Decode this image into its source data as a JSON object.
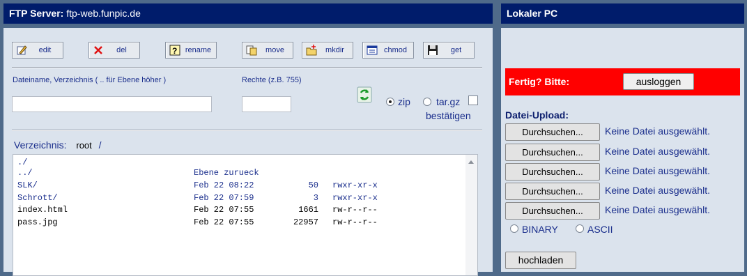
{
  "ftp": {
    "title_label": "FTP Server:",
    "host": "ftp-web.funpic.de",
    "toolbar": [
      {
        "label": "edit",
        "icon": "edit-icon"
      },
      {
        "label": "del",
        "icon": "delete-icon"
      },
      {
        "label": "rename",
        "icon": "rename-icon"
      },
      {
        "label": "move",
        "icon": "move-icon"
      },
      {
        "label": "mkdir",
        "icon": "mkdir-icon"
      },
      {
        "label": "chmod",
        "icon": "chmod-icon"
      },
      {
        "label": "get",
        "icon": "get-icon"
      }
    ],
    "filename_label": "Dateiname, Verzeichnis ( .. für Ebene höher )",
    "filename_value": "",
    "rights_label": "Rechte (z.B. 755)",
    "rights_value": "",
    "zip_label": "zip",
    "targz_label": "tar.gz",
    "confirm_label": "bestätigen",
    "dir_label": "Verzeichnis:",
    "dir_root": "root",
    "dir_sep": "/",
    "files": [
      {
        "name": "./",
        "date": "",
        "size": "",
        "perm": "",
        "link": true
      },
      {
        "name": "../",
        "date": "Ebene zurueck",
        "size": "",
        "perm": "",
        "link": true
      },
      {
        "name": "SLK/",
        "date": "Feb 22 08:22",
        "size": "50",
        "perm": "rwxr-xr-x",
        "link": true
      },
      {
        "name": "Schrott/",
        "date": "Feb 22 07:59",
        "size": "3",
        "perm": "rwxr-xr-x",
        "link": true
      },
      {
        "name": "index.html",
        "date": "Feb 22 07:55",
        "size": "1661",
        "perm": "rw-r--r--",
        "link": false
      },
      {
        "name": "pass.jpg",
        "date": "Feb 22 07:55",
        "size": "22957",
        "perm": "rw-r--r--",
        "link": false
      }
    ]
  },
  "local": {
    "title": "Lokaler PC",
    "done_label": "Fertig? Bitte:",
    "logout_label": "ausloggen",
    "upload_heading": "Datei-Upload:",
    "browse_label": "Durchsuchen...",
    "no_file_label": "Keine Datei ausgewählt.",
    "binary_label": "BINARY",
    "ascii_label": "ASCII",
    "upload_button": "hochladen"
  },
  "colors": {
    "title_bg": "#001c6b",
    "panel_bg": "#dbe3ed",
    "alert_red": "#ff0000",
    "link_blue": "#1a2e8c"
  }
}
